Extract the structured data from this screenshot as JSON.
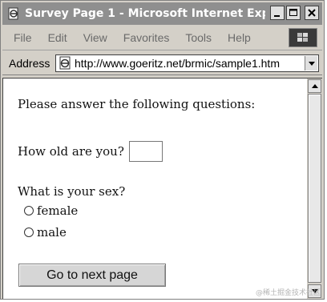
{
  "window": {
    "title": "Survey Page 1 - Microsoft Internet Expl..."
  },
  "menubar": {
    "items": [
      "File",
      "Edit",
      "View",
      "Favorites",
      "Tools",
      "Help"
    ]
  },
  "addressbar": {
    "label": "Address",
    "url": "http://www.goeritz.net/brmic/sample1.htm"
  },
  "page": {
    "intro": "Please answer the following questions:",
    "age_question": "How old are you?",
    "age_value": "",
    "sex_question": "What is your sex?",
    "sex_options": [
      "female",
      "male"
    ],
    "next_button": "Go to next page"
  },
  "watermark": "@稀土掘金技术社区",
  "colors": {
    "titlebar_bg": "#8f8f8f",
    "chrome_bg": "#d4d0c8",
    "content_bg": "#ffffff"
  },
  "icons": {
    "app": "ie-page-icon",
    "throbber": "windows-logo-icon",
    "address_page": "ie-page-icon"
  }
}
